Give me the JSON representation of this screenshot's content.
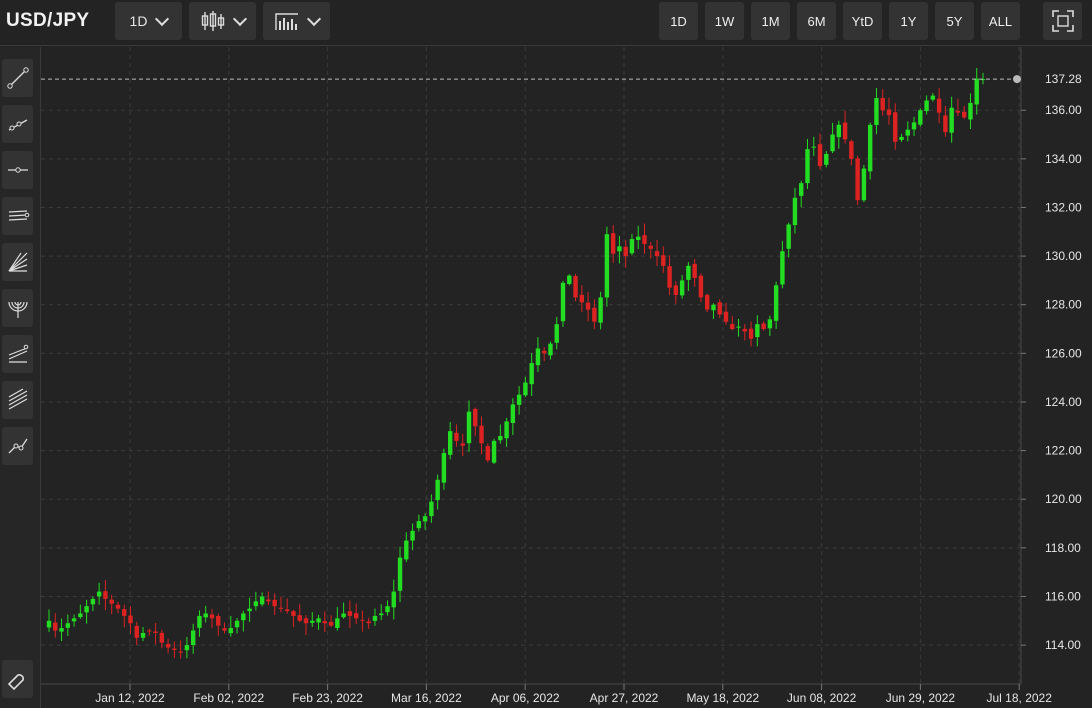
{
  "header": {
    "symbol": "USD/JPY",
    "interval_label": "1D",
    "chart_type_icon": "candlestick-icon",
    "indicators_icon": "indicators-icon",
    "ranges": [
      "1D",
      "1W",
      "1M",
      "6M",
      "YtD",
      "1Y",
      "5Y",
      "ALL"
    ],
    "fullscreen_icon": "fullscreen-icon"
  },
  "sidebar": {
    "tools": [
      "trend-line-icon",
      "ray-icon",
      "horizontal-line-icon",
      "parallel-channel-icon",
      "fib-fan-icon",
      "fib-arcs-icon",
      "pitchfork-icon",
      "fib-channel-icon",
      "path-icon"
    ],
    "bottom_tool": "magnet-icon"
  },
  "colors": {
    "up": "#22dd22",
    "down": "#dd2222",
    "grid": "#3b3b3b",
    "background": "#232323"
  },
  "chart_data": {
    "type": "candlestick",
    "last_price": "137.28",
    "ylim": [
      112.4,
      138.6
    ],
    "yticks": [
      "114.00",
      "116.00",
      "118.00",
      "120.00",
      "122.00",
      "124.00",
      "126.00",
      "128.00",
      "130.00",
      "132.00",
      "134.00",
      "136.00"
    ],
    "xticks": [
      "Jan 12, 2022",
      "Feb 02, 2022",
      "Feb 23, 2022",
      "Mar 16, 2022",
      "Apr 06, 2022",
      "Apr 27, 2022",
      "May 18, 2022",
      "Jun 08, 2022",
      "Jun 29, 2022",
      "Jul 18, 2022"
    ],
    "grid": true,
    "close_path": [
      115.0,
      114.6,
      114.7,
      114.9,
      115.1,
      115.3,
      115.6,
      115.9,
      116.2,
      115.9,
      115.7,
      115.5,
      115.2,
      114.9,
      114.3,
      114.5,
      114.6,
      114.5,
      114.1,
      113.9,
      113.8,
      113.7,
      114.0,
      114.6,
      115.2,
      115.3,
      115.1,
      114.8,
      114.6,
      114.7,
      115.0,
      115.3,
      115.5,
      115.8,
      116.0,
      115.8,
      115.6,
      115.5,
      115.4,
      115.2,
      115.0,
      114.9,
      115.0,
      115.1,
      114.9,
      114.8,
      115.1,
      115.3,
      115.2,
      115.1,
      115.0,
      114.9,
      115.2,
      115.3,
      115.6,
      116.2,
      117.6,
      118.3,
      118.7,
      119.1,
      119.3,
      119.9,
      120.8,
      121.9,
      122.8,
      122.4,
      122.2,
      123.6,
      123.0,
      122.3,
      121.6,
      122.4,
      122.6,
      123.2,
      123.9,
      124.3,
      124.8,
      125.6,
      126.2,
      126.0,
      126.4,
      127.2,
      128.9,
      129.2,
      128.3,
      128.1,
      127.8,
      127.3,
      128.3,
      130.9,
      130.1,
      130.4,
      130.0,
      130.7,
      130.8,
      130.5,
      130.3,
      130.0,
      129.6,
      128.7,
      128.4,
      129.0,
      129.6,
      129.1,
      128.3,
      127.8,
      128.0,
      127.6,
      127.3,
      127.0,
      127.1,
      126.9,
      126.6,
      127.2,
      127.0,
      127.4,
      128.8,
      130.2,
      131.3,
      132.4,
      133.0,
      134.4,
      134.5,
      133.7,
      134.2,
      135.0,
      135.4,
      134.8,
      134.0,
      132.3,
      133.6,
      135.4,
      136.5,
      136.0,
      135.8,
      134.7,
      134.9,
      135.2,
      135.5,
      136.0,
      136.4,
      136.6,
      135.9,
      135.1,
      136.1,
      135.9,
      135.7,
      136.3,
      137.3,
      137.28
    ]
  }
}
